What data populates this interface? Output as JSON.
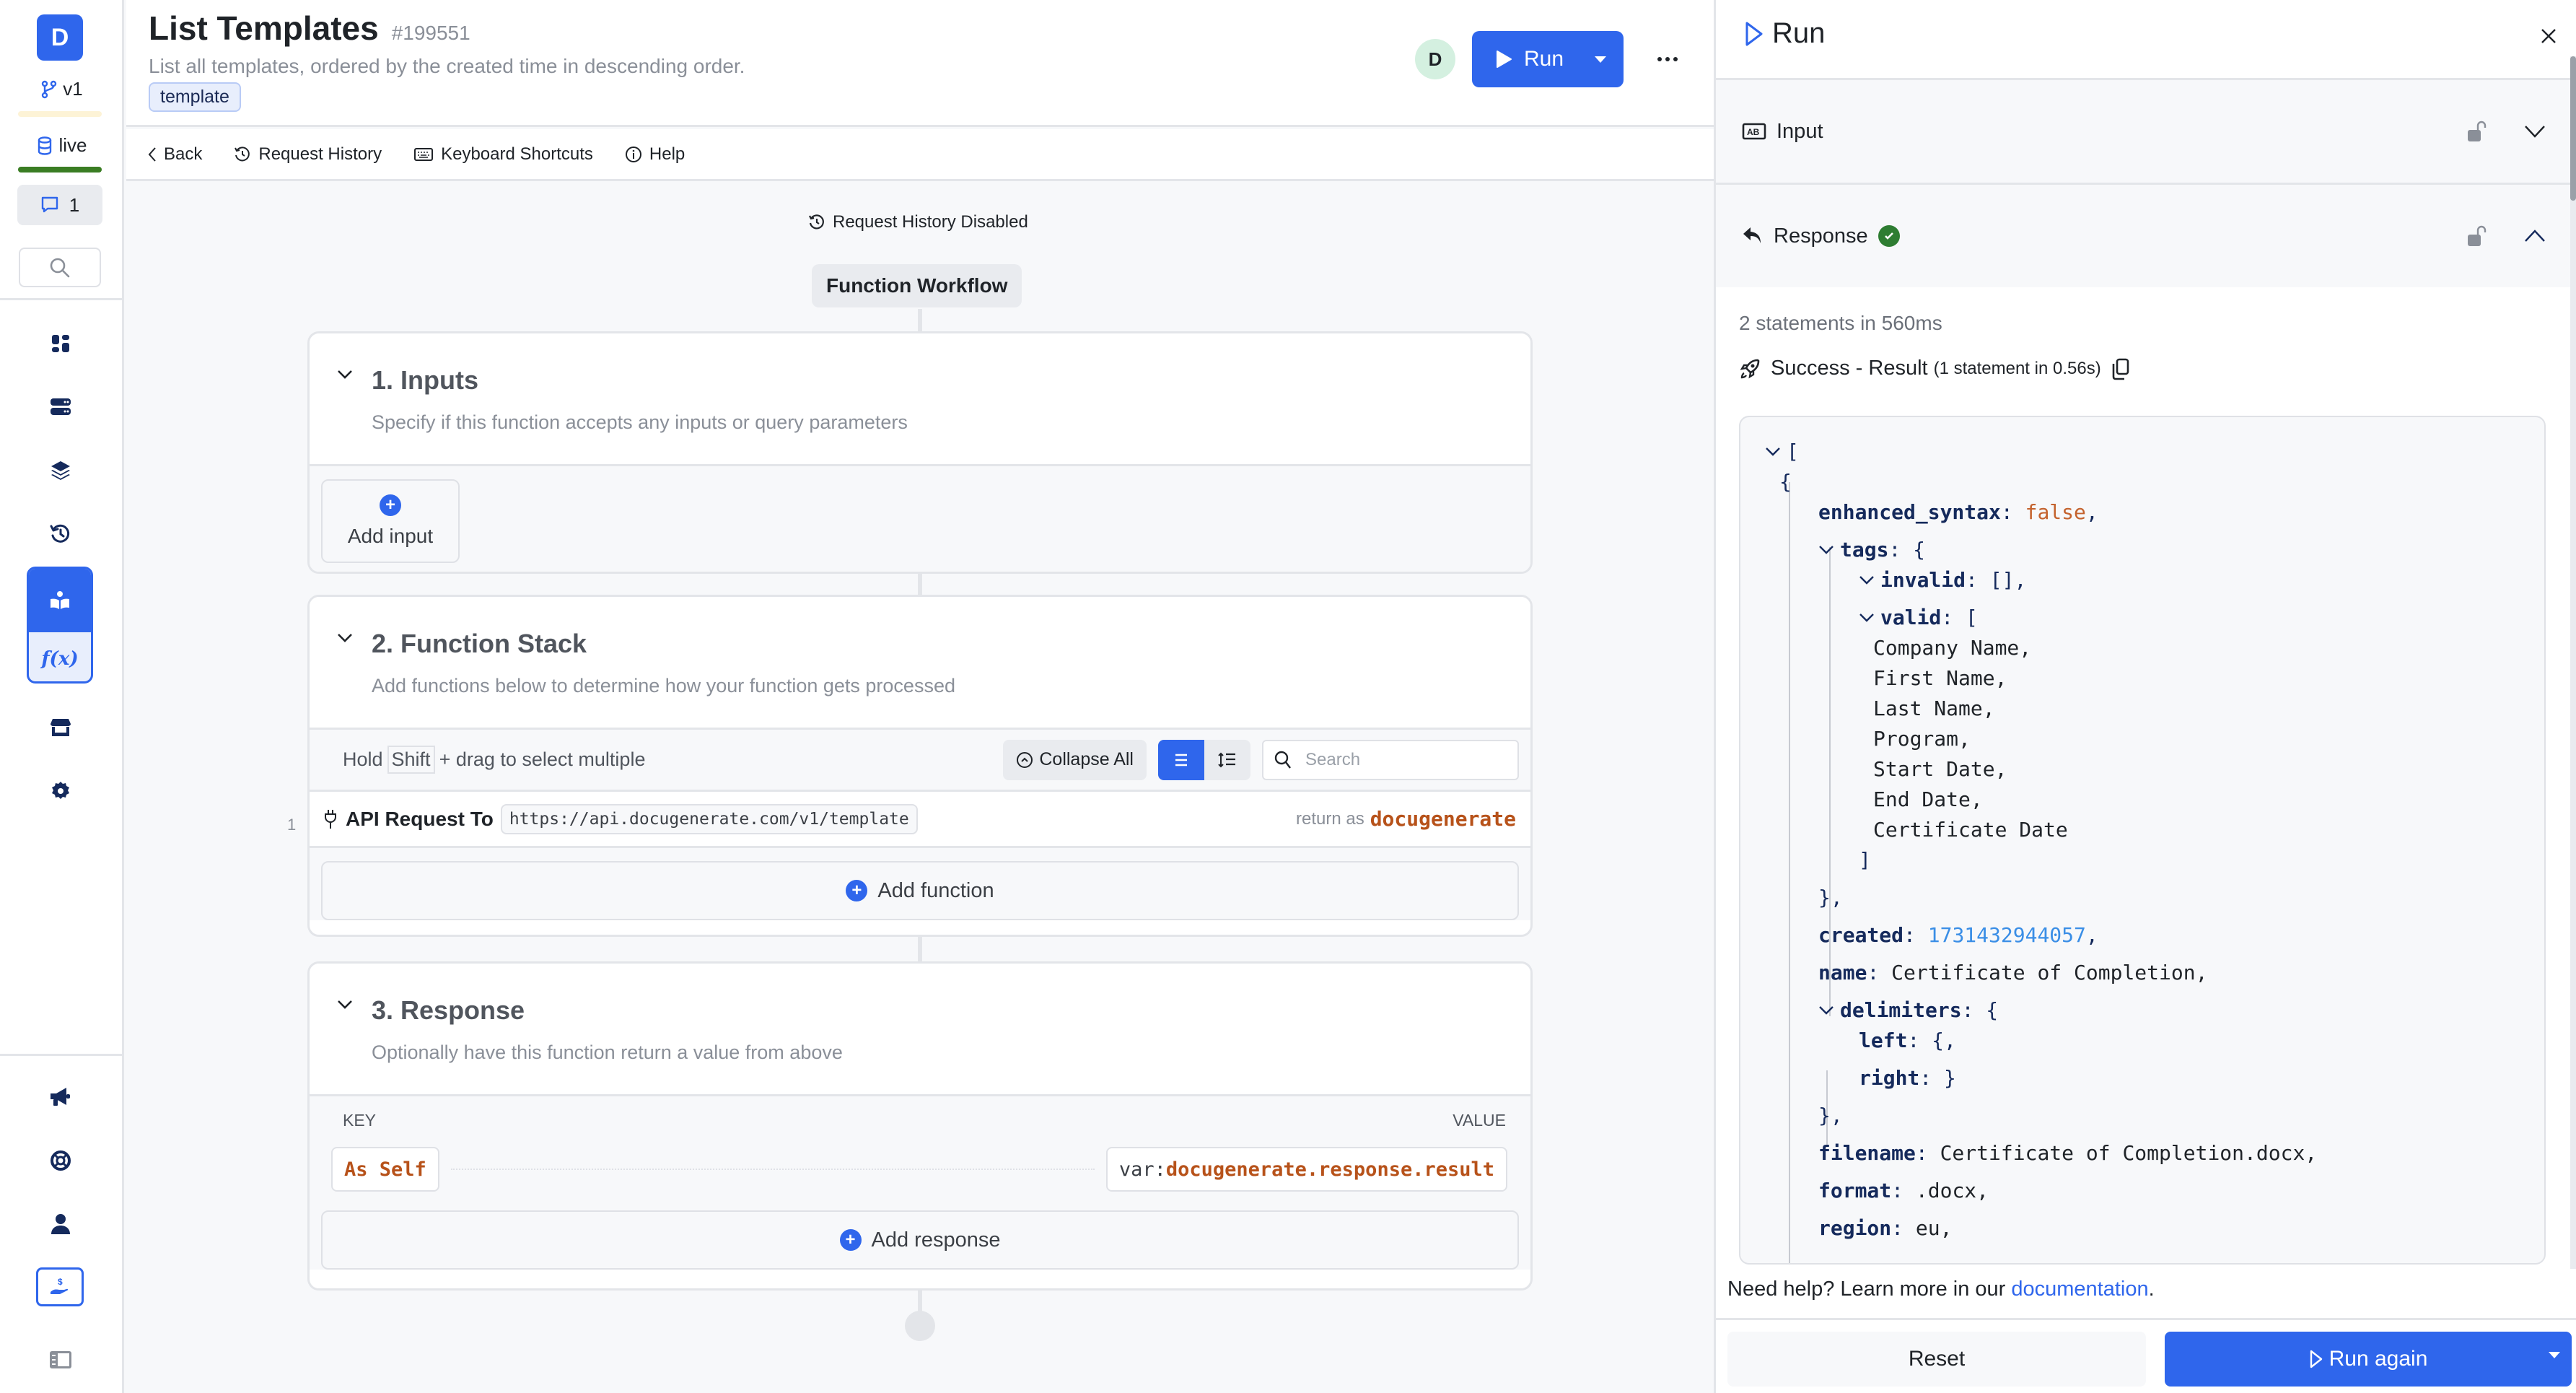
{
  "sidebar": {
    "workspace_initial": "D",
    "branch": "v1",
    "environment": "live",
    "comment_count": "1",
    "colors": {
      "branch_bar": "#fdf3d6",
      "env_bar": "#3a7d23",
      "accent": "#2f66ec"
    },
    "nav_top": [
      {
        "icon": "dashboard-icon"
      },
      {
        "icon": "database-icon"
      },
      {
        "icon": "layers-icon"
      },
      {
        "icon": "history-icon"
      },
      {
        "icon": "library-icon",
        "active": true
      },
      {
        "icon": "function-icon",
        "label": "f(x)",
        "active": true
      },
      {
        "icon": "marketplace-icon"
      },
      {
        "icon": "settings-icon"
      }
    ],
    "nav_bottom": [
      {
        "icon": "megaphone-icon"
      },
      {
        "icon": "lifebuoy-icon"
      },
      {
        "icon": "user-icon"
      },
      {
        "icon": "billing-icon"
      },
      {
        "icon": "toggle-sidebar-icon"
      }
    ]
  },
  "header": {
    "title": "List Templates",
    "id": "#199551",
    "description": "List all templates, ordered by the created time in descending order.",
    "tag": "template",
    "user_initial": "D",
    "run_label": "Run"
  },
  "toolbar": {
    "back": "Back",
    "request_history": "Request History",
    "keyboard_shortcuts": "Keyboard Shortcuts",
    "help": "Help"
  },
  "canvas": {
    "request_history_status": "Request History Disabled",
    "workflow_label": "Function Workflow",
    "inputs": {
      "title": "1. Inputs",
      "description": "Specify if this function accepts any inputs or query parameters",
      "add_label": "Add input"
    },
    "stack": {
      "title": "2. Function Stack",
      "description": "Add functions below to determine how your function gets processed",
      "hint_prefix": "Hold",
      "hint_key": "Shift",
      "hint_suffix": "+ drag to select multiple",
      "collapse_all": "Collapse All",
      "search_placeholder": "Search",
      "functions": [
        {
          "line": "1",
          "name": "API Request To",
          "url": "https://api.docugenerate.com/v1/template",
          "return_prefix": "return as",
          "return_var": "docugenerate"
        }
      ],
      "add_label": "Add function"
    },
    "response": {
      "title": "3. Response",
      "description": "Optionally have this function return a value from above",
      "key_header": "KEY",
      "value_header": "VALUE",
      "rows": [
        {
          "key": "As Self",
          "value_prefix": "var:",
          "value": "docugenerate.response.result"
        }
      ],
      "add_label": "Add response"
    }
  },
  "run_panel": {
    "title": "Run",
    "input_label": "Input",
    "response_label": "Response",
    "stats": "2 statements in 560ms",
    "result_label": "Success - Result",
    "result_detail": "(1 statement in 0.56s)",
    "json": {
      "open_bracket": "[",
      "open_brace": "{",
      "enhanced_syntax_key": "enhanced_syntax",
      "enhanced_syntax_val": "false",
      "tags_key": "tags",
      "invalid_key": "invalid",
      "invalid_val": "[],",
      "valid_key": "valid",
      "valid_items": [
        "Company Name,",
        "First Name,",
        "Last Name,",
        "Program,",
        "Start Date,",
        "End Date,",
        "Certificate Date"
      ],
      "close_valid": "]",
      "close_tags": "},",
      "created_key": "created",
      "created_val": "1731432944057",
      "name_key": "name",
      "name_val": "Certificate of Completion,",
      "delimiters_key": "delimiters",
      "left_key": "left",
      "left_val": "{,",
      "right_key": "right",
      "right_val": "}",
      "close_delimiters": "},",
      "filename_key": "filename",
      "filename_val": "Certificate of Completion.docx,",
      "format_key": "format",
      "format_val": ".docx,",
      "region_key": "region",
      "region_val": "eu,"
    },
    "help_text": "Need help? Learn more in our",
    "help_link": "documentation",
    "help_suffix": ".",
    "reset_label": "Reset",
    "run_again_label": "Run again"
  }
}
